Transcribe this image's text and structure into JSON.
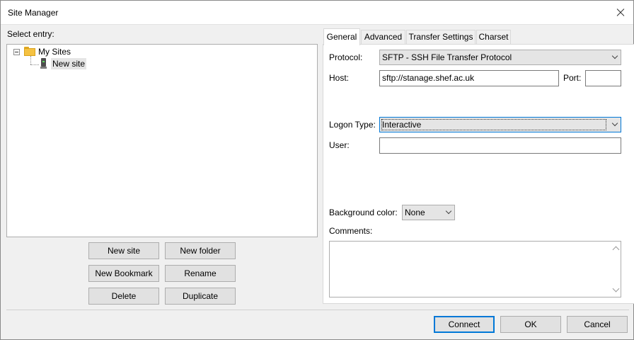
{
  "window": {
    "title": "Site Manager"
  },
  "tree": {
    "label": "Select entry:",
    "root": "My Sites",
    "child": "New site"
  },
  "left_buttons": {
    "new_site": "New site",
    "new_folder": "New folder",
    "new_bookmark": "New Bookmark",
    "rename": "Rename",
    "delete": "Delete",
    "duplicate": "Duplicate"
  },
  "tabs": [
    "General",
    "Advanced",
    "Transfer Settings",
    "Charset"
  ],
  "general": {
    "protocol_label": "Protocol:",
    "protocol_value": "SFTP - SSH File Transfer Protocol",
    "host_label": "Host:",
    "host_value": "sftp://stanage.shef.ac.uk",
    "port_label": "Port:",
    "port_value": "",
    "logon_label": "Logon Type:",
    "logon_value": "Interactive",
    "user_label": "User:",
    "user_value": "",
    "bgcolor_label": "Background color:",
    "bgcolor_value": "None",
    "comments_label": "Comments:",
    "comments_value": ""
  },
  "footer": {
    "connect": "Connect",
    "ok": "OK",
    "cancel": "Cancel"
  },
  "colors": {
    "accent": "#0078d7",
    "panel": "#f0f0f0",
    "folder": "#f5c242"
  },
  "icons": [
    "close-icon",
    "folder-icon",
    "site-server-icon",
    "chevron-down-icon",
    "tree-collapse-icon"
  ]
}
